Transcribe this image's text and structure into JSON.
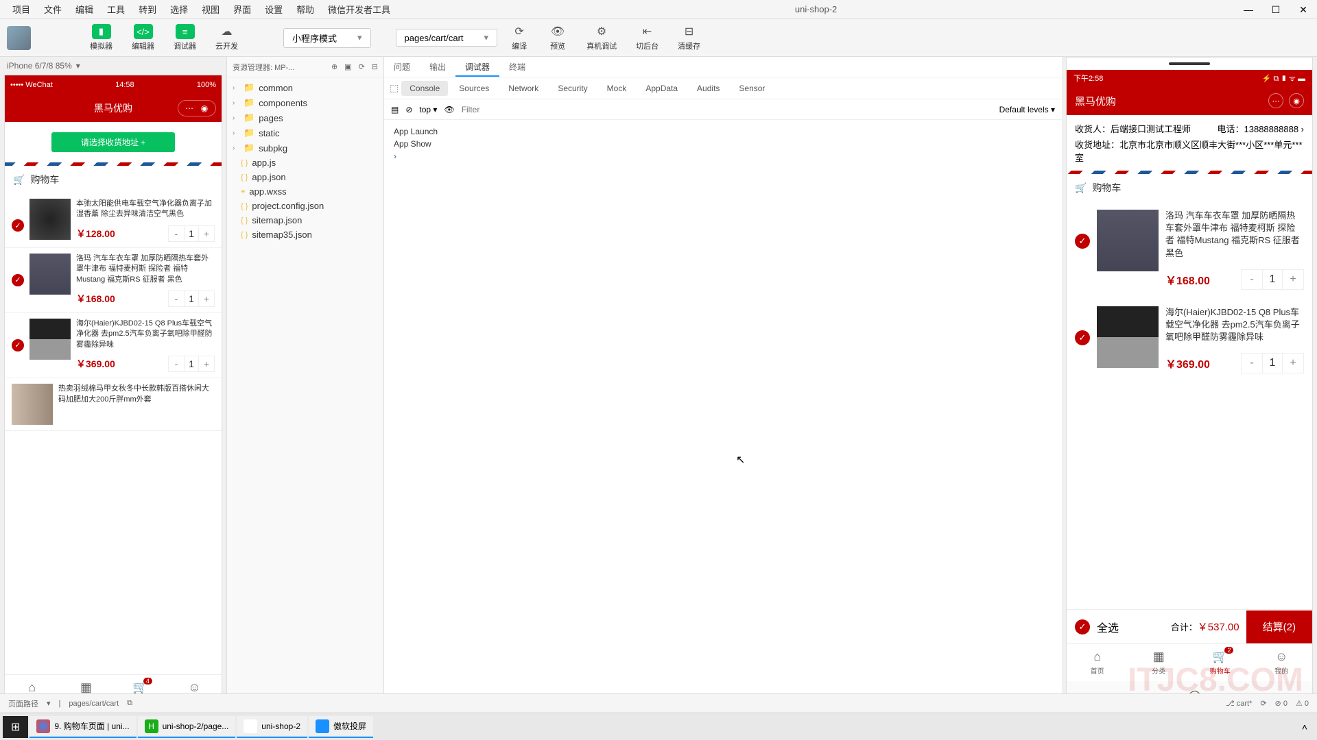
{
  "window": {
    "title": "uni-shop-2",
    "menu": [
      "项目",
      "文件",
      "编辑",
      "工具",
      "转到",
      "选择",
      "视图",
      "界面",
      "设置",
      "帮助",
      "微信开发者工具"
    ]
  },
  "toolbar": {
    "buttons": [
      "模拟器",
      "编辑器",
      "调试器",
      "云开发"
    ],
    "mode_dropdown": "小程序模式",
    "page_dropdown": "pages/cart/cart",
    "right": [
      "编译",
      "预览",
      "真机调试",
      "切后台",
      "清缓存"
    ]
  },
  "simulator": {
    "device_info": "iPhone 6/7/8 85%",
    "status_left": "••••• WeChat",
    "status_time": "14:58",
    "status_right": "100%",
    "nav_title": "黑马优购",
    "address_btn": "请选择收货地址 +",
    "cart_title": "购物车",
    "items": [
      {
        "title": "本弛太阳能供电车载空气净化器负离子加湿香薰 除尘去异味清洁空气黑色",
        "price": "￥128.00",
        "qty": "1"
      },
      {
        "title": "洛玛 汽车车衣车罩 加厚防晒隔热车套外罩牛津布 福特麦柯斯 探险者 福特Mustang 福克斯RS 征服者 黑色",
        "price": "￥168.00",
        "qty": "1"
      },
      {
        "title": "海尔(Haier)KJBD02-15 Q8 Plus车载空气净化器 去pm2.5汽车负离子氧吧除甲醛防雾霾除异味",
        "price": "￥369.00",
        "qty": "1"
      },
      {
        "title": "热卖羽绒棉马甲女秋冬中长款韩版百搭休闲大码加肥加大200斤胖mm外套",
        "price": "",
        "qty": ""
      }
    ],
    "tabs": [
      "首页",
      "分类",
      "购物车",
      "我的"
    ],
    "tab_badge": "4"
  },
  "tree": {
    "header": "资源管理器: MP-...",
    "folders": [
      "common",
      "components",
      "pages",
      "static",
      "subpkg"
    ],
    "files": [
      "app.js",
      "app.json",
      "app.wxss",
      "project.config.json",
      "sitemap.json",
      "sitemap35.json"
    ]
  },
  "debug": {
    "tabs1": [
      "问题",
      "输出",
      "调试器",
      "终端"
    ],
    "tabs2": [
      "Console",
      "Sources",
      "Network",
      "Security",
      "Mock",
      "AppData",
      "Audits",
      "Sensor"
    ],
    "context": "top",
    "filter_placeholder": "Filter",
    "levels": "Default levels",
    "console": [
      "App  Launch",
      "App  Show"
    ]
  },
  "preview": {
    "time": "下午2:58",
    "nav_title": "黑马优购",
    "recipient_label": "收货人：",
    "recipient": "后端接口测试工程师",
    "phone_label": "电话：",
    "phone": "13888888888",
    "address_label": "收货地址：",
    "address": "北京市北京市顺义区顺丰大街***小区***单元***室",
    "cart_title": "购物车",
    "items": [
      {
        "title": "洛玛 汽车车衣车罩 加厚防晒隔热车套外罩牛津布 福特麦柯斯 探险者 福特Mustang 福克斯RS 征服者 黑色",
        "price": "￥168.00",
        "qty": "1"
      },
      {
        "title": "海尔(Haier)KJBD02-15 Q8 Plus车载空气净化器 去pm2.5汽车负离子氧吧除甲醛防雾霾除异味",
        "price": "￥369.00",
        "qty": "1"
      }
    ],
    "select_all": "全选",
    "total_label": "合计：",
    "total_price": "￥537.00",
    "checkout": "结算(2)",
    "tabs": [
      "首页",
      "分类",
      "购物车",
      "我的"
    ],
    "tab_badge": "2"
  },
  "statusbar": {
    "left": "页面路径",
    "path": "pages/cart/cart",
    "branch": "cart*",
    "errors": "0",
    "warnings": "0"
  },
  "taskbar": [
    "9. 购物车页面 | uni...",
    "uni-shop-2/page...",
    "uni-shop-2",
    "傲软投屏"
  ],
  "watermark": "ITJC8.COM"
}
